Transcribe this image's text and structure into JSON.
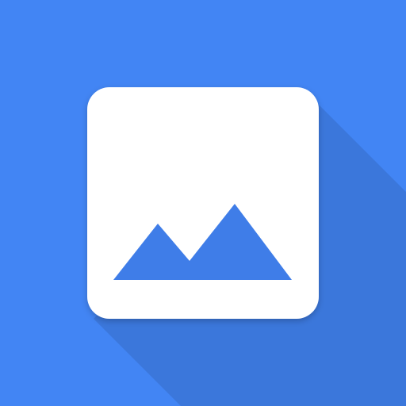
{
  "icon": {
    "name": "gallery-app-icon",
    "glyph": "mountains-image-icon",
    "colors": {
      "background": "#4285F4",
      "long_shadow": "#3B77DB",
      "card": "#FFFFFF",
      "mountains": "#3F7DE8"
    }
  }
}
